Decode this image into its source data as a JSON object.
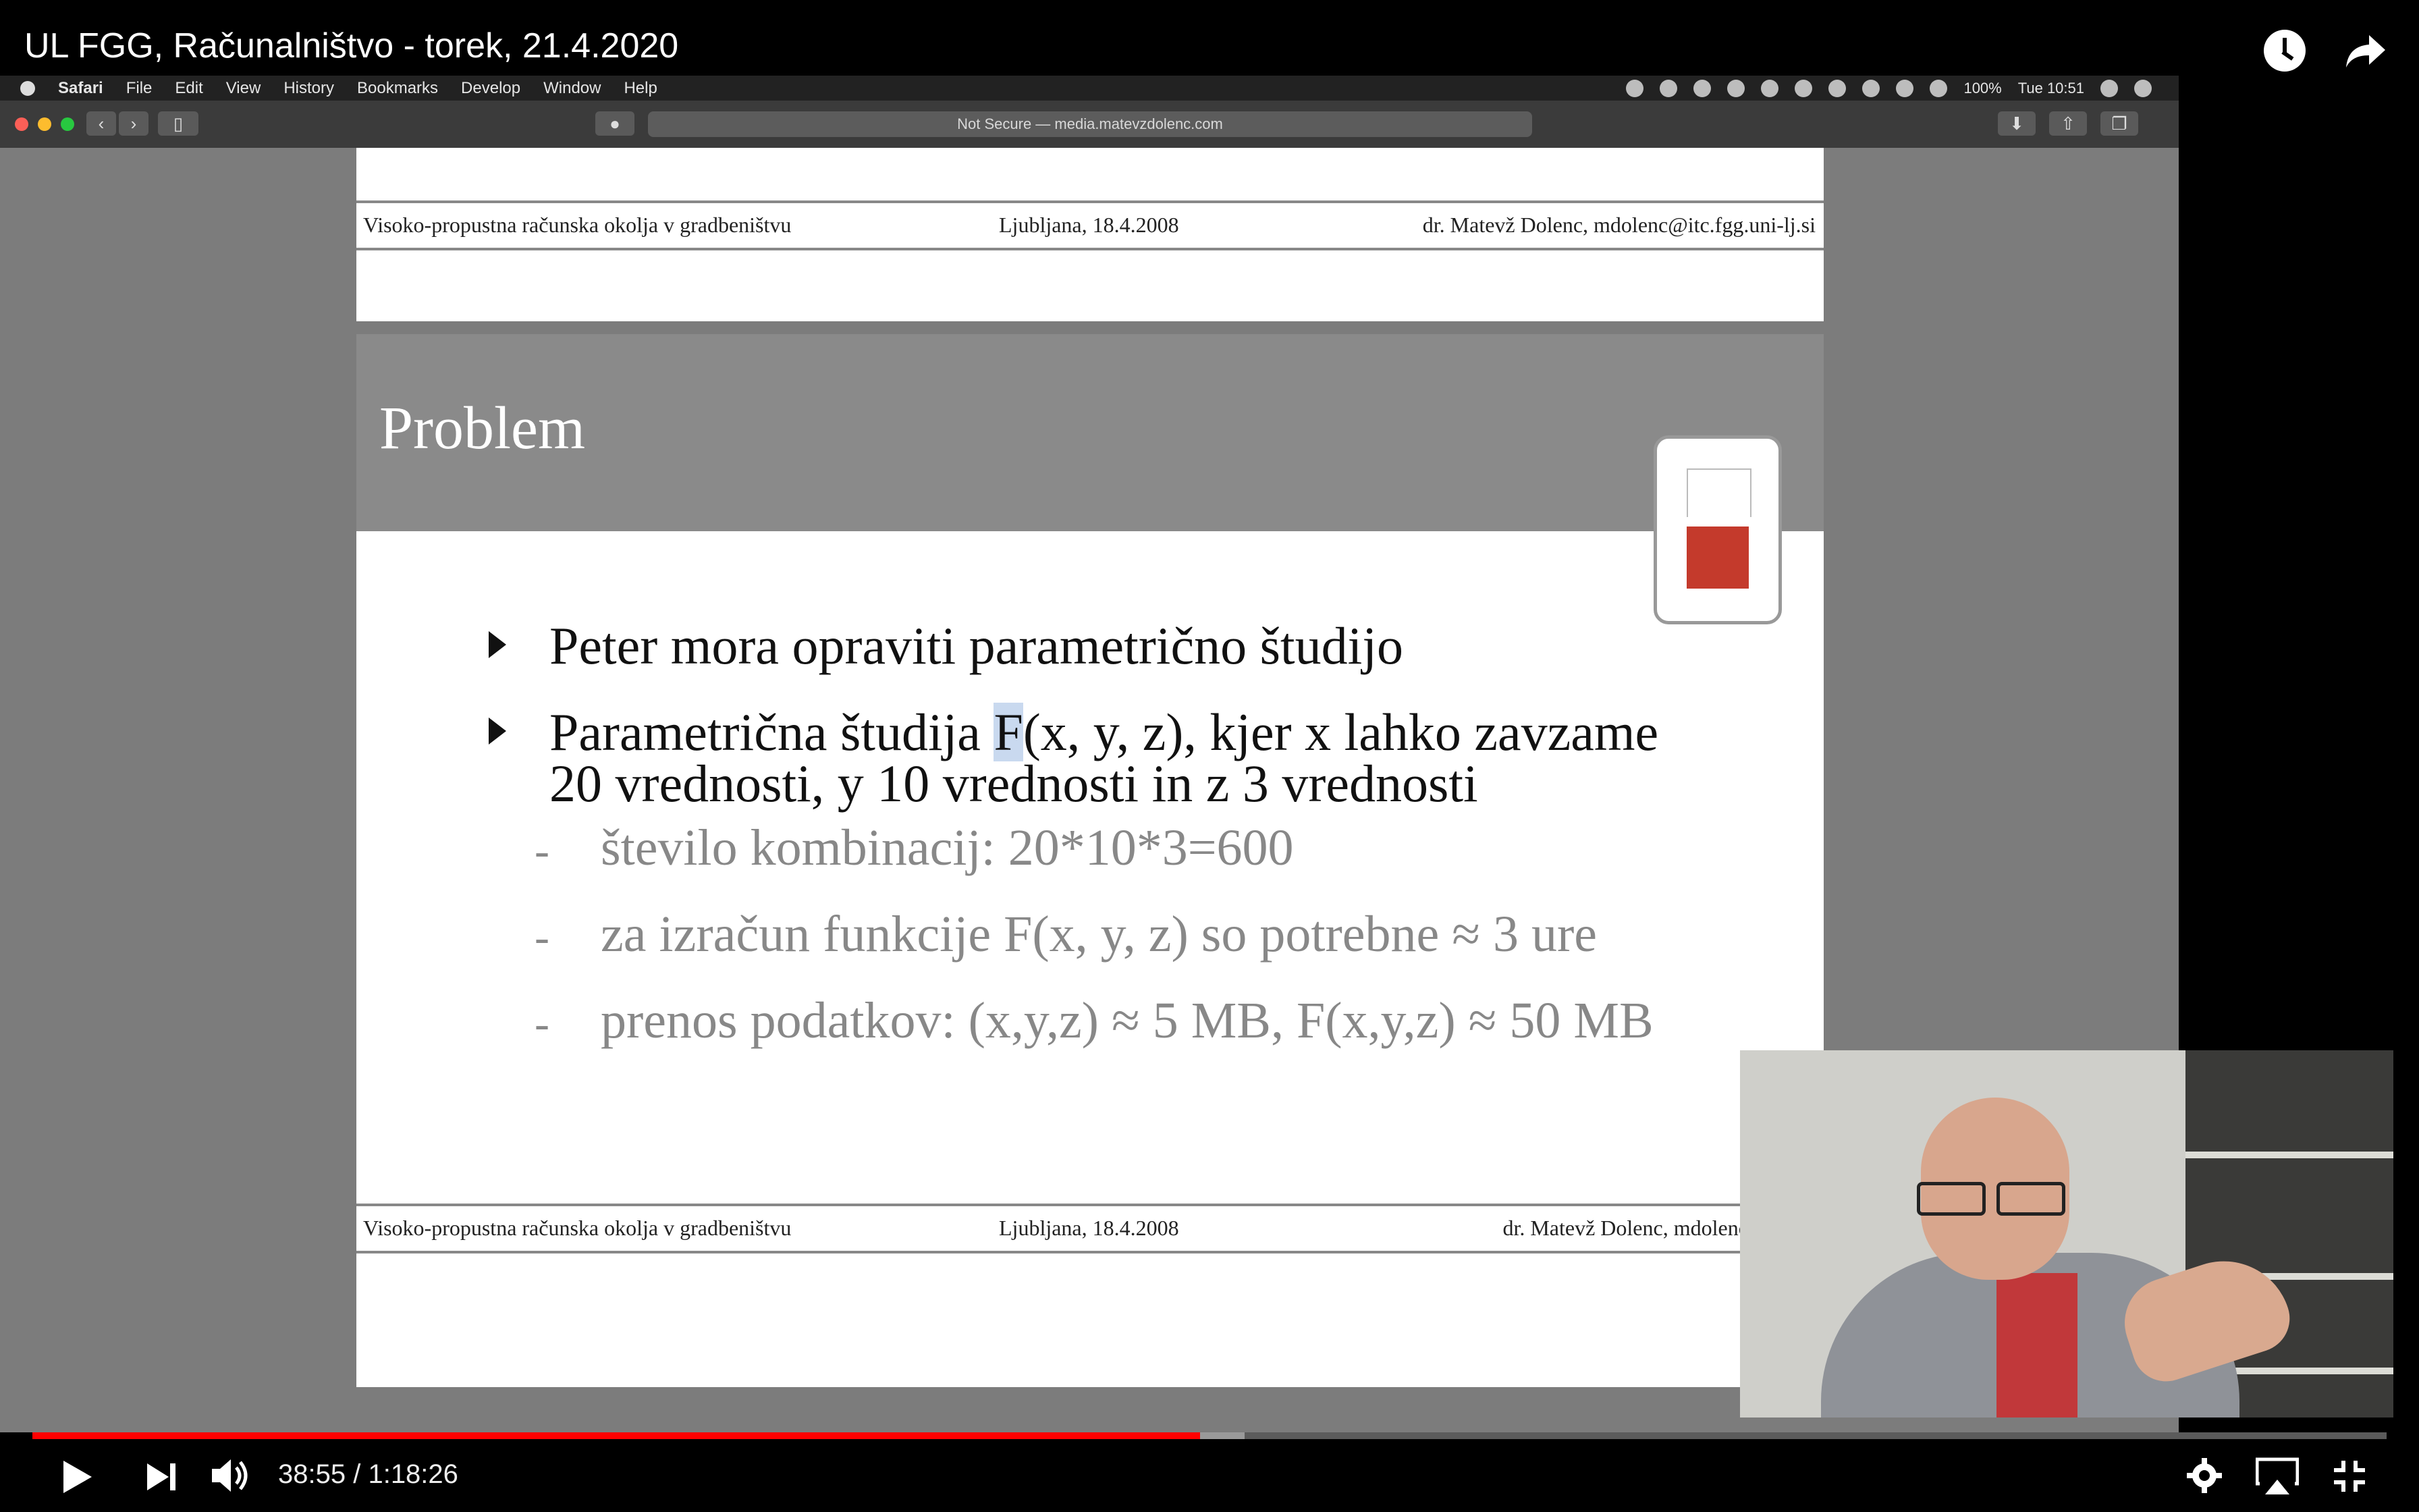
{
  "video": {
    "title": "UL FGG, Računalništvo - torek, 21.4.2020",
    "time_current": "38:55",
    "time_separator": " / ",
    "time_total": "1:18:26",
    "progress": 0.496
  },
  "safari": {
    "menus": [
      "Safari",
      "File",
      "Edit",
      "View",
      "History",
      "Bookmarks",
      "Develop",
      "Window",
      "Help"
    ],
    "battery": "100%",
    "clock": "Tue 10:51",
    "url": "Not Secure — media.matevzdolenc.com"
  },
  "slide": {
    "header_left": "Visoko-propustna računska okolja v gradbeništvu",
    "header_center": "Ljubljana, 18.4.2008",
    "header_right": "dr. Matevž Dolenc, mdolenc@itc.fgg.uni-lj.si",
    "title": "Problem",
    "bullet1": "Peter mora opraviti parametrično študijo",
    "bullet2_line1_pre": "Parametrična študija ",
    "bullet2_line1_hl": "F",
    "bullet2_line1_post": "(x, y, z), kjer x lahko zavzame",
    "bullet2_line2": "20 vrednosti, y 10 vrednosti in z 3 vrednosti",
    "sub1": "število kombinacij: 20*10*3=600",
    "sub2": "za izračun funkcije F(x, y, z) so potrebne ≈ 3 ure",
    "sub3": "prenos podatkov: (x,y,z) ≈ 5 MB, F(x,y,z) ≈ 50 MB",
    "dash": "-",
    "footer_left": "Visoko-propustna računska okolja v gradbeništvu",
    "footer_center": "Ljubljana, 18.4.2008",
    "footer_right": "dr. Matevž Dolenc, mdolenc@itc.fgg"
  }
}
